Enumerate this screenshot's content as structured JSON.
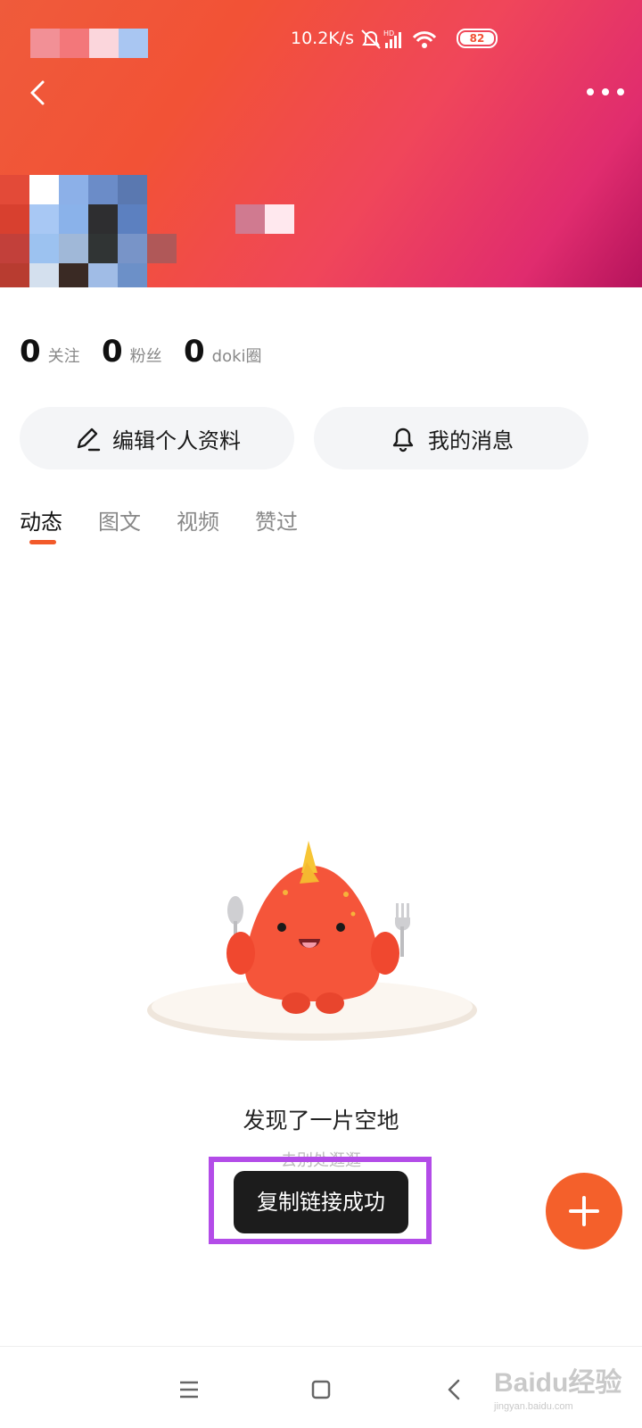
{
  "status_bar": {
    "net_speed": "10.2K/s",
    "battery": "82"
  },
  "stats": [
    {
      "value": "0",
      "label": "关注"
    },
    {
      "value": "0",
      "label": "粉丝"
    },
    {
      "value": "0",
      "label": "doki圈"
    }
  ],
  "actions": {
    "edit_profile": "编辑个人资料",
    "messages": "我的消息"
  },
  "tabs": [
    "动态",
    "图文",
    "视频",
    "赞过"
  ],
  "empty_state": {
    "title": "发现了一片空地",
    "subtitle": "去别处逛逛"
  },
  "toast": "复制链接成功",
  "watermark": {
    "text": "Baidu经验",
    "sub": "jingyan.baidu.com"
  },
  "colors": {
    "accent": "#f4602b",
    "toast_highlight": "#b34ce8",
    "header_start": "#ef5b3b",
    "header_end": "#b5135c"
  }
}
